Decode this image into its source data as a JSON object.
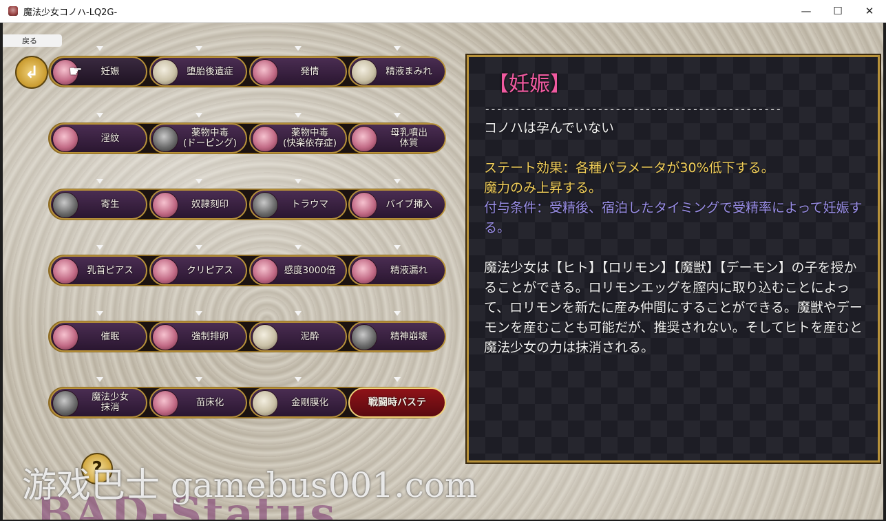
{
  "window": {
    "title": "魔法少女コノハ-LQ2G-",
    "minimize": "—",
    "maximize": "☐",
    "close": "✕"
  },
  "back_label": "戻る",
  "back_icon_glyph": "↲",
  "help_glyph": "?",
  "pointer_glyph": "☛",
  "rows": [
    [
      "妊娠",
      "堕胎後遺症",
      "発情",
      "精液まみれ"
    ],
    [
      "淫紋",
      "薬物中毒\n(ドーピング)",
      "薬物中毒\n(快楽依存症)",
      "母乳噴出\n体質"
    ],
    [
      "寄生",
      "奴隷刻印",
      "トラウマ",
      "バイブ挿入"
    ],
    [
      "乳首ピアス",
      "クリピアス",
      "感度3000倍",
      "精液漏れ"
    ],
    [
      "催眠",
      "強制排卵",
      "泥酔",
      "精神崩壊"
    ],
    [
      "魔法少女\n抹消",
      "苗床化",
      "金剛膜化",
      "戦闘時バステ"
    ]
  ],
  "info": {
    "title": "【妊娠】",
    "separator": "--------------------------------------------------",
    "status": "コノハは孕んでいない",
    "effect": "ステート効果：各種パラメータが30%低下する。\n魔力のみ上昇する。",
    "condition": "付与条件：受精後、宿泊したタイミングで受精率によって妊娠する。",
    "description": "魔法少女は【ヒト】【ロリモン】【魔獣】【デーモン】の子を授かることができる。ロリモンエッグを膣内に取り込むことによって、ロリモンを新たに産み仲間にすることができる。魔獣やデーモンを産むことも可能だが、推奨されない。そしてヒトを産むと魔法少女の力は抹消される。"
  },
  "watermark": "游戏巴士 gamebus001.com",
  "background_title": "BAD-Status",
  "colors": {
    "title_pink": "#f05aa0",
    "effect_yellow": "#f2cf5a",
    "condition_purple": "#9b8fe9",
    "gold": "#b8923a"
  }
}
